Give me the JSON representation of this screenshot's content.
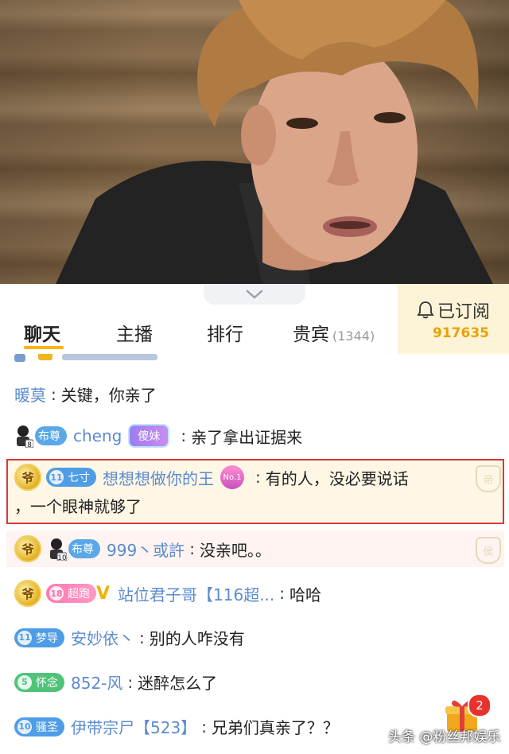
{
  "tabs": {
    "chat": "聊天",
    "anchor": "主播",
    "ranking": "排行",
    "vip": "贵宾",
    "vip_count": "(1344)"
  },
  "subscribe": {
    "label": "已订阅",
    "count": "917635"
  },
  "messages": [
    {
      "user": "暖莫",
      "text": "关键，你亲了"
    },
    {
      "badge": "布尊",
      "user": "cheng",
      "tag": "傻妹",
      "text": "亲了拿出证据来"
    },
    {
      "badge": "七寸",
      "badge_level": "11",
      "user": "想想想做你的王",
      "tag": "No.1",
      "text_line1": "有的人，没必要说话",
      "text_line2": "，一个眼神就够了"
    },
    {
      "badge": "布尊",
      "user": "999丶或許",
      "text": "没亲吧。。"
    },
    {
      "badge": "超跑",
      "badge_level": "18",
      "user": "站位君子哥【116超...",
      "text": "哈哈"
    },
    {
      "badge": "梦导",
      "badge_level": "11",
      "user": "安妙依丶",
      "text": "别的人咋没有"
    },
    {
      "badge": "怀念",
      "badge_level": "5",
      "user": "852-风",
      "text": "迷醉怎么了"
    },
    {
      "badge": "骚圣",
      "badge_level": "10",
      "user": "伊带宗尸【523】",
      "text": "兄弟们真亲了？？"
    }
  ],
  "avatar_levels": {
    "first": "8",
    "second": "10"
  },
  "medal_label": "爷",
  "emblem_label": "帝",
  "emblem2_label": "侯",
  "gift_badge": "2",
  "watermark": "头条 @粉丝邦娱乐",
  "colors": {
    "accent": "#ffb400",
    "username": "#5b8bd0",
    "subscribe_bg": "#fdf3d7",
    "subscribe_count": "#e8a200",
    "highlight_border": "#d83a3a"
  }
}
